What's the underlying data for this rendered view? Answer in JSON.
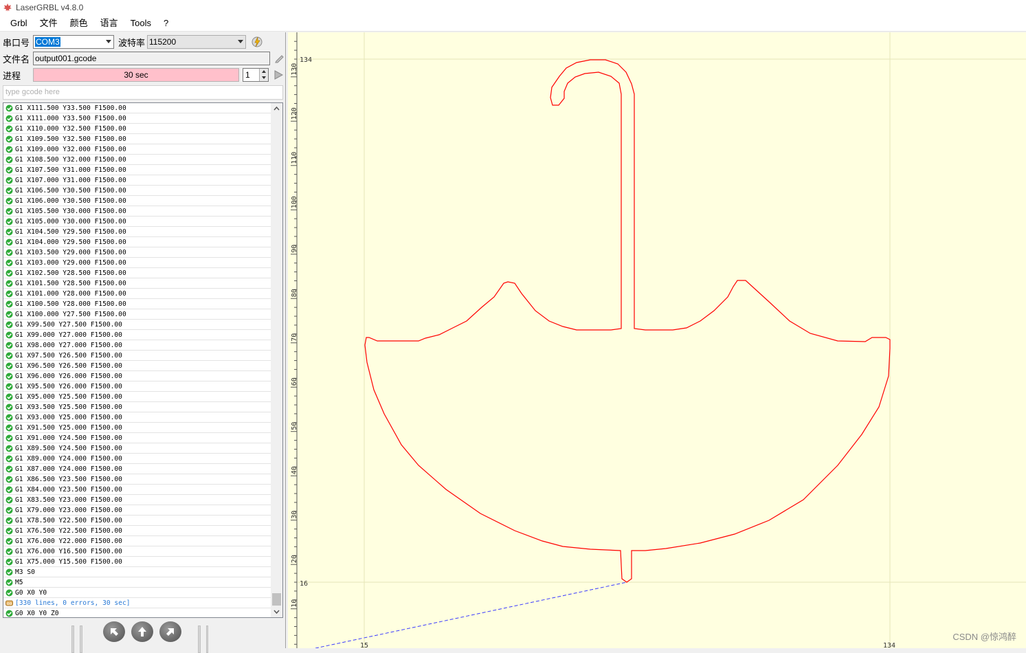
{
  "window": {
    "title": "LaserGRBL v4.8.0",
    "icon": "maple-leaf-icon"
  },
  "menu": [
    "Grbl",
    "文件",
    "颜色",
    "语言",
    "Tools",
    "?"
  ],
  "connection": {
    "port_label": "串口号",
    "port_value": "COM3",
    "baud_label": "波特率",
    "baud_value": "115200"
  },
  "file": {
    "label": "文件名",
    "value": "output001.gcode"
  },
  "progress": {
    "label": "进程",
    "text": "30 sec",
    "passes": "1"
  },
  "gcode_input": {
    "placeholder": "type gcode here"
  },
  "log": [
    "G1 X111.500 Y33.500 F1500.00",
    "G1 X111.000 Y33.500 F1500.00",
    "G1 X110.000 Y32.500 F1500.00",
    "G1 X109.500 Y32.500 F1500.00",
    "G1 X109.000 Y32.000 F1500.00",
    "G1 X108.500 Y32.000 F1500.00",
    "G1 X107.500 Y31.000 F1500.00",
    "G1 X107.000 Y31.000 F1500.00",
    "G1 X106.500 Y30.500 F1500.00",
    "G1 X106.000 Y30.500 F1500.00",
    "G1 X105.500 Y30.000 F1500.00",
    "G1 X105.000 Y30.000 F1500.00",
    "G1 X104.500 Y29.500 F1500.00",
    "G1 X104.000 Y29.500 F1500.00",
    "G1 X103.500 Y29.000 F1500.00",
    "G1 X103.000 Y29.000 F1500.00",
    "G1 X102.500 Y28.500 F1500.00",
    "G1 X101.500 Y28.500 F1500.00",
    "G1 X101.000 Y28.000 F1500.00",
    "G1 X100.500 Y28.000 F1500.00",
    "G1 X100.000 Y27.500 F1500.00",
    "G1 X99.500 Y27.500 F1500.00",
    "G1 X99.000 Y27.000 F1500.00",
    "G1 X98.000 Y27.000 F1500.00",
    "G1 X97.500 Y26.500 F1500.00",
    "G1 X96.500 Y26.500 F1500.00",
    "G1 X96.000 Y26.000 F1500.00",
    "G1 X95.500 Y26.000 F1500.00",
    "G1 X95.000 Y25.500 F1500.00",
    "G1 X93.500 Y25.500 F1500.00",
    "G1 X93.000 Y25.000 F1500.00",
    "G1 X91.500 Y25.000 F1500.00",
    "G1 X91.000 Y24.500 F1500.00",
    "G1 X89.500 Y24.500 F1500.00",
    "G1 X89.000 Y24.000 F1500.00",
    "G1 X87.000 Y24.000 F1500.00",
    "G1 X86.500 Y23.500 F1500.00",
    "G1 X84.000 Y23.500 F1500.00",
    "G1 X83.500 Y23.000 F1500.00",
    "G1 X79.000 Y23.000 F1500.00",
    "G1 X78.500 Y22.500 F1500.00",
    "G1 X76.500 Y22.500 F1500.00",
    "G1 X76.000 Y22.000 F1500.00",
    "G1 X76.000 Y16.500 F1500.00",
    "G1 X75.000 Y15.500 F1500.00",
    "M3 S0",
    "M5",
    "G0 X0 Y0",
    "[330 lines, 0 errors, 30 sec]",
    "G0 X0 Y0 Z0"
  ],
  "preview": {
    "y_ticks": [
      "10",
      "20",
      "30",
      "40",
      "50",
      "60",
      "70",
      "80",
      "90",
      "100",
      "110",
      "120",
      "130"
    ],
    "y_bounds": [
      "134",
      "16"
    ],
    "x_bounds": [
      "15",
      "134"
    ],
    "path_color": "#ff0000",
    "rapid_color": "#3a3aff",
    "background_color": "#ffffe0"
  },
  "watermark": "CSDN @惊鸿醉"
}
